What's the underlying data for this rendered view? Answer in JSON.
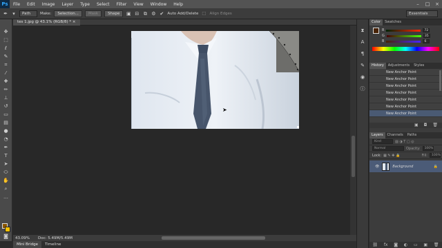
{
  "menu": [
    "File",
    "Edit",
    "Image",
    "Layer",
    "Type",
    "Select",
    "Filter",
    "View",
    "Window",
    "Help"
  ],
  "logo": "Ps",
  "window_controls": [
    "–",
    "□",
    "×"
  ],
  "options": {
    "mode_value": "Path",
    "make_label": "Make:",
    "selection_btn": "Selection...",
    "mask_btn": "Mask",
    "shape_btn": "Shape",
    "auto_add_delete": "Auto Add/Delete",
    "align_edges": "Align Edges",
    "workspace": "Essentials"
  },
  "document": {
    "tab_title": "tes 1.jpg @ 43.1% (RGB/8) *",
    "zoom": "43.09%",
    "doc_info": "Doc: 5.49M/5.49M"
  },
  "bottom_tabs": [
    "Mini Bridge",
    "Timeline"
  ],
  "color_panel": {
    "tabs": [
      "Color",
      "Swatches"
    ],
    "channels": [
      {
        "label": "R",
        "value": "72"
      },
      {
        "label": "G",
        "value": "35"
      },
      {
        "label": "B",
        "value": "6"
      }
    ],
    "fg_color": "#482306",
    "bg_color": "#f5c000"
  },
  "history_panel": {
    "tabs": [
      "History",
      "Adjustments",
      "Styles"
    ],
    "items": [
      "New Anchor Point",
      "New Anchor Point",
      "New Anchor Point",
      "New Anchor Point",
      "New Anchor Point",
      "New Anchor Point",
      "New Anchor Point"
    ]
  },
  "layers_panel": {
    "tabs": [
      "Layers",
      "Channels",
      "Paths"
    ],
    "kind_label": "Kind",
    "blend_mode": "Normal",
    "opacity_label": "Opacity:",
    "opacity_value": "100%",
    "lock_label": "Lock:",
    "fill_label": "Fill:",
    "fill_value": "100%",
    "layer_name": "Background"
  }
}
